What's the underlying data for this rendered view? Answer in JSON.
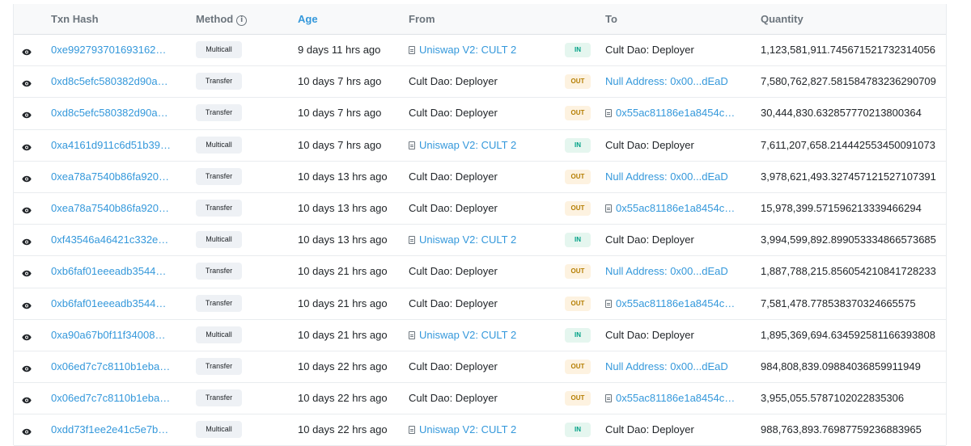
{
  "headers": {
    "txn_hash": "Txn Hash",
    "method": "Method",
    "info_icon": "i",
    "age": "Age",
    "from": "From",
    "to": "To",
    "quantity": "Quantity"
  },
  "icons": {
    "row_preview": "eye-icon",
    "contract": "document-icon",
    "method_info": "info-circle-icon"
  },
  "colors": {
    "link": "#3498db",
    "in_badge": "#00a186",
    "out_badge": "#b47d00",
    "header_bg": "#f8f9fa"
  },
  "rows": [
    {
      "hash": "0xe9927937016931623b...",
      "method": "Multicall",
      "age": "9 days 11 hrs ago",
      "from": "Uniswap V2: CULT 2",
      "dir": "IN",
      "to": "Cult Dao: Deployer",
      "qty": "1,123,581,911.745671521732314056"
    },
    {
      "hash": "0xd8c5efc580382d90a0...",
      "method": "Transfer",
      "age": "10 days 7 hrs ago",
      "from": "Cult Dao: Deployer",
      "dir": "OUT",
      "to": "Null Address: 0x00...dEaD",
      "qty": "7,580,762,827.581584783236290709"
    },
    {
      "hash": "0xd8c5efc580382d90a0...",
      "method": "Transfer",
      "age": "10 days 7 hrs ago",
      "from": "Cult Dao: Deployer",
      "dir": "OUT",
      "to": "0x55ac81186e1a8454c7...",
      "qty": "30,444,830.632857770213800364"
    },
    {
      "hash": "0xa4161d911c6d51b39c...",
      "method": "Multicall",
      "age": "10 days 7 hrs ago",
      "from": "Uniswap V2: CULT 2",
      "dir": "IN",
      "to": "Cult Dao: Deployer",
      "qty": "7,611,207,658.214442553450091073"
    },
    {
      "hash": "0xea78a7540b86fa9209...",
      "method": "Transfer",
      "age": "10 days 13 hrs ago",
      "from": "Cult Dao: Deployer",
      "dir": "OUT",
      "to": "Null Address: 0x00...dEaD",
      "qty": "3,978,621,493.327457121527107391"
    },
    {
      "hash": "0xea78a7540b86fa9209...",
      "method": "Transfer",
      "age": "10 days 13 hrs ago",
      "from": "Cult Dao: Deployer",
      "dir": "OUT",
      "to": "0x55ac81186e1a8454c7...",
      "qty": "15,978,399.571596213339466294"
    },
    {
      "hash": "0xf43546a46421c332e3...",
      "method": "Multicall",
      "age": "10 days 13 hrs ago",
      "from": "Uniswap V2: CULT 2",
      "dir": "IN",
      "to": "Cult Dao: Deployer",
      "qty": "3,994,599,892.899053334866573685"
    },
    {
      "hash": "0xb6faf01eeeadb354438...",
      "method": "Transfer",
      "age": "10 days 21 hrs ago",
      "from": "Cult Dao: Deployer",
      "dir": "OUT",
      "to": "Null Address: 0x00...dEaD",
      "qty": "1,887,788,215.856054210841728233"
    },
    {
      "hash": "0xb6faf01eeeadb354438...",
      "method": "Transfer",
      "age": "10 days 21 hrs ago",
      "from": "Cult Dao: Deployer",
      "dir": "OUT",
      "to": "0x55ac81186e1a8454c7...",
      "qty": "7,581,478.778538370324665575"
    },
    {
      "hash": "0xa90a67b0f11f340087b...",
      "method": "Multicall",
      "age": "10 days 21 hrs ago",
      "from": "Uniswap V2: CULT 2",
      "dir": "IN",
      "to": "Cult Dao: Deployer",
      "qty": "1,895,369,694.634592581166393808"
    },
    {
      "hash": "0x06ed7c7c8110b1eba2f...",
      "method": "Transfer",
      "age": "10 days 22 hrs ago",
      "from": "Cult Dao: Deployer",
      "dir": "OUT",
      "to": "Null Address: 0x00...dEaD",
      "qty": "984,808,839.09884036859911949"
    },
    {
      "hash": "0x06ed7c7c8110b1eba2f...",
      "method": "Transfer",
      "age": "10 days 22 hrs ago",
      "from": "Cult Dao: Deployer",
      "dir": "OUT",
      "to": "0x55ac81186e1a8454c7...",
      "qty": "3,955,055.5787102022835306"
    },
    {
      "hash": "0xdd73f1ee2e41c5e7b0...",
      "method": "Multicall",
      "age": "10 days 22 hrs ago",
      "from": "Uniswap V2: CULT 2",
      "dir": "IN",
      "to": "Cult Dao: Deployer",
      "qty": "988,763,893.76987759236883965"
    }
  ]
}
